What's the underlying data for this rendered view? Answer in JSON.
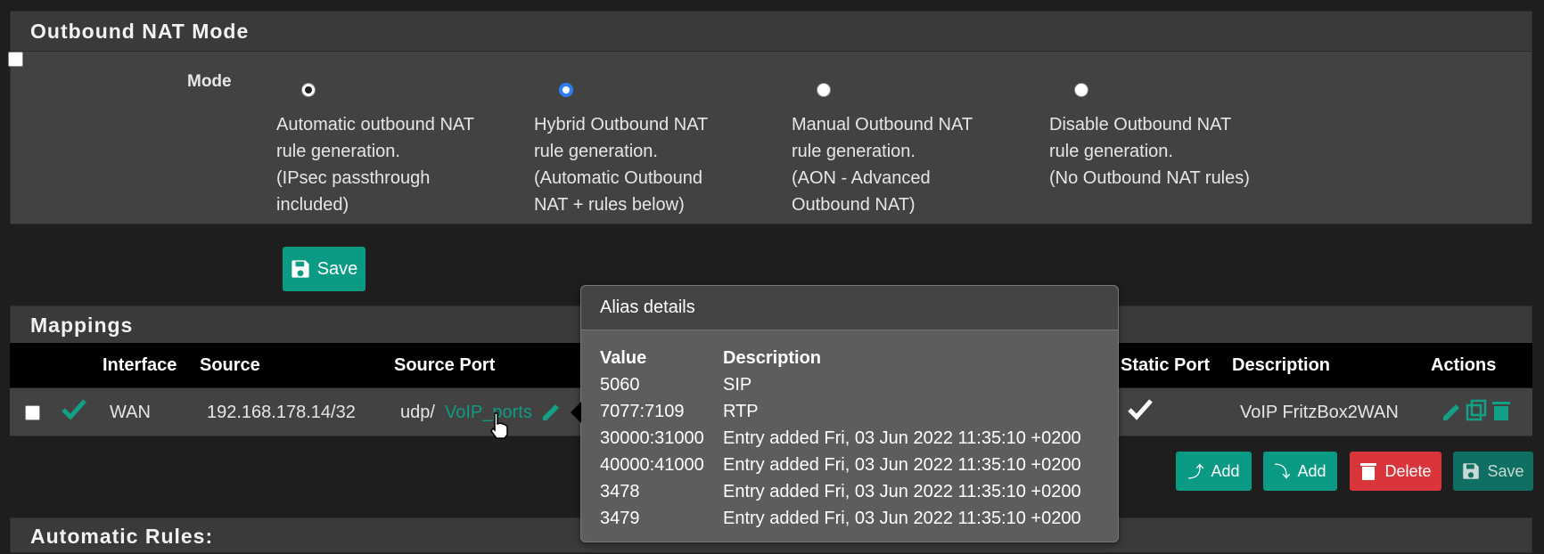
{
  "nat": {
    "title": "Outbound NAT Mode",
    "mode_label": "Mode",
    "options": [
      {
        "l1": "Automatic outbound NAT",
        "l2": "rule generation.",
        "l3": "(IPsec passthrough",
        "l4": "included)"
      },
      {
        "l1": "Hybrid Outbound NAT",
        "l2": "rule generation.",
        "l3": "(Automatic Outbound",
        "l4": "NAT + rules below)"
      },
      {
        "l1": "Manual Outbound NAT",
        "l2": "rule generation.",
        "l3": "(AON - Advanced",
        "l4": "Outbound NAT)"
      },
      {
        "l1": "Disable Outbound NAT",
        "l2": "rule generation.",
        "l3": "(No Outbound NAT rules)",
        "l4": ""
      }
    ],
    "save_label": "Save"
  },
  "mappings": {
    "title": "Mappings",
    "headers": {
      "interface": "Interface",
      "source": "Source",
      "source_port": "Source Port",
      "static_port": "Static Port",
      "description": "Description",
      "actions": "Actions"
    },
    "row": {
      "interface": "WAN",
      "source": "192.168.178.14/32",
      "proto": "udp/",
      "alias": "VoIP_ports",
      "description": "VoIP FritzBox2WAN"
    }
  },
  "buttons": {
    "add_top": "Add",
    "add_bottom": "Add",
    "delete": "Delete",
    "save": "Save"
  },
  "tooltip": {
    "title": "Alias details",
    "col_value": "Value",
    "col_desc": "Description",
    "rows": [
      {
        "value": "5060",
        "desc": "SIP"
      },
      {
        "value": "7077:7109",
        "desc": "RTP"
      },
      {
        "value": "30000:31000",
        "desc": "Entry added Fri, 03 Jun 2022 11:35:10 +0200"
      },
      {
        "value": "40000:41000",
        "desc": "Entry added Fri, 03 Jun 2022 11:35:10 +0200"
      },
      {
        "value": "3478",
        "desc": "Entry added Fri, 03 Jun 2022 11:35:10 +0200"
      },
      {
        "value": "3479",
        "desc": "Entry added Fri, 03 Jun 2022 11:35:10 +0200"
      }
    ]
  },
  "auto": {
    "title": "Automatic Rules:"
  },
  "colors": {
    "accent": "#0b9a83",
    "danger": "#d9353b",
    "header_bg": "#000000",
    "panel_bg": "#424242"
  }
}
